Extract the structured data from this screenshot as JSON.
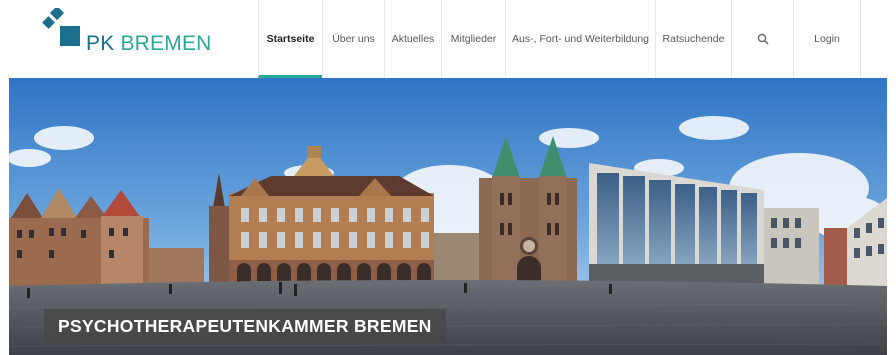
{
  "logo": {
    "pk": "PK",
    "city": "BREMEN",
    "mark_color": "#1a6f8c",
    "text_color": "#2aa89a"
  },
  "nav": {
    "items": [
      {
        "label": "Startseite",
        "active": true
      },
      {
        "label": "Über uns"
      },
      {
        "label": "Aktuelles"
      },
      {
        "label": "Mitglieder"
      },
      {
        "label": "Aus-, Fort- und Weiterbildung"
      },
      {
        "label": "Ratsuchende"
      }
    ],
    "search_icon": "search-icon",
    "login_label": "Login",
    "accent": "#2aa89a"
  },
  "hero": {
    "caption": "PSYCHOTHERAPEUTENKAMMER BREMEN",
    "subject": "Bremen Marktplatz panorama: Rathaus, St. Petri Dom, Haus der Bürgerschaft"
  }
}
